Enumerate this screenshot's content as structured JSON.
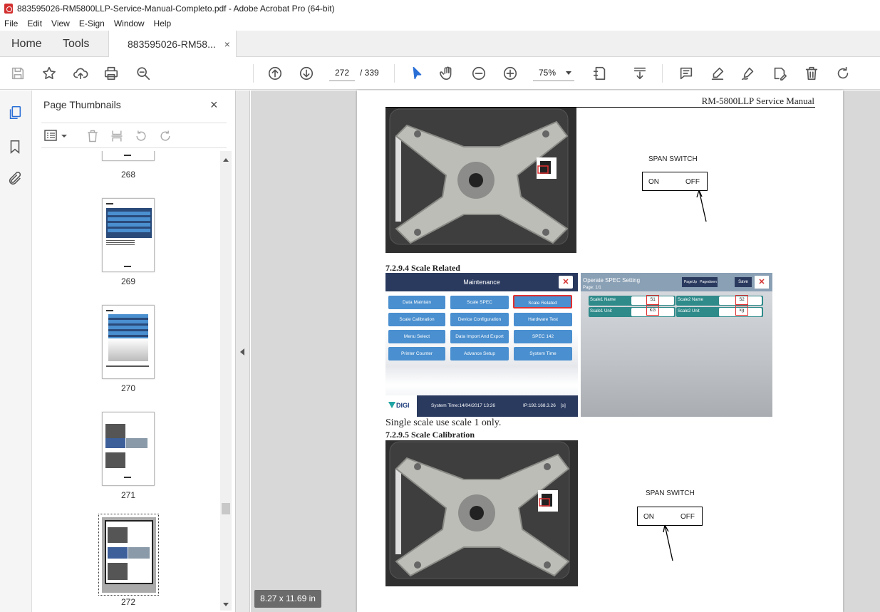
{
  "window": {
    "title": "883595026-RM5800LLP-Service-Manual-Completo.pdf - Adobe Acrobat Pro (64-bit)"
  },
  "menu": [
    "File",
    "Edit",
    "View",
    "E-Sign",
    "Window",
    "Help"
  ],
  "tabs": {
    "home": "Home",
    "tools": "Tools",
    "doc": "883595026-RM58...",
    "close": "×"
  },
  "nav": {
    "current_page": "272",
    "total_pages": "/ 339",
    "zoom": "75%"
  },
  "panel": {
    "title": "Page Thumbnails",
    "close": "×",
    "thumbnails": [
      "268",
      "269",
      "270",
      "271",
      "272"
    ]
  },
  "status": {
    "page_size": "8.27 x 11.69 in"
  },
  "doc": {
    "header": "RM-5800LLP Service Manual",
    "span_switch_1": "SPAN SWITCH",
    "on": "ON",
    "off": "OFF",
    "section_1": "7.2.9.4  Scale Related",
    "maintenance": {
      "title": "Maintenance",
      "close": "✕",
      "buttons": [
        "Data  Maintain",
        "Scale  SPEC",
        "Scale  Related",
        "Scale  Calibration",
        "Device  Configuration",
        "Hardware  Test",
        "Menu  Select",
        "Data  Import  And  Export",
        "SPEC  142",
        "Printer  Counter",
        "Advance  Setup",
        "System  Time"
      ],
      "brand": "DIGI",
      "system_time": "System  Time:14/04/2017  13:26",
      "ip": "IP:192.168.3.26",
      "ind": "[s]"
    },
    "spec": {
      "title": "Operate SPEC Setting",
      "page": "Page: 1/1",
      "pageup": "PageUp",
      "pagedown": "Pagedown",
      "save": "Save",
      "close": "✕",
      "s1name_label": "Scale1  Name",
      "s1name_val": "S1",
      "s2name_label": "Scale2  Name",
      "s2name_val": "S2",
      "s1unit_label": "Scale1  Unit",
      "s1unit_val": "KG",
      "s2unit_label": "Scale2  Unit",
      "s2unit_val": "kg"
    },
    "single_scale": "Single scale use scale 1 only.",
    "section_2": "7.2.9.5  Scale Calibration",
    "span_switch_2": "SPAN SWITCH"
  },
  "colors": {
    "accent": "#4a8fcf",
    "highlight": "#e03030",
    "navy": "#2a3a5f"
  }
}
